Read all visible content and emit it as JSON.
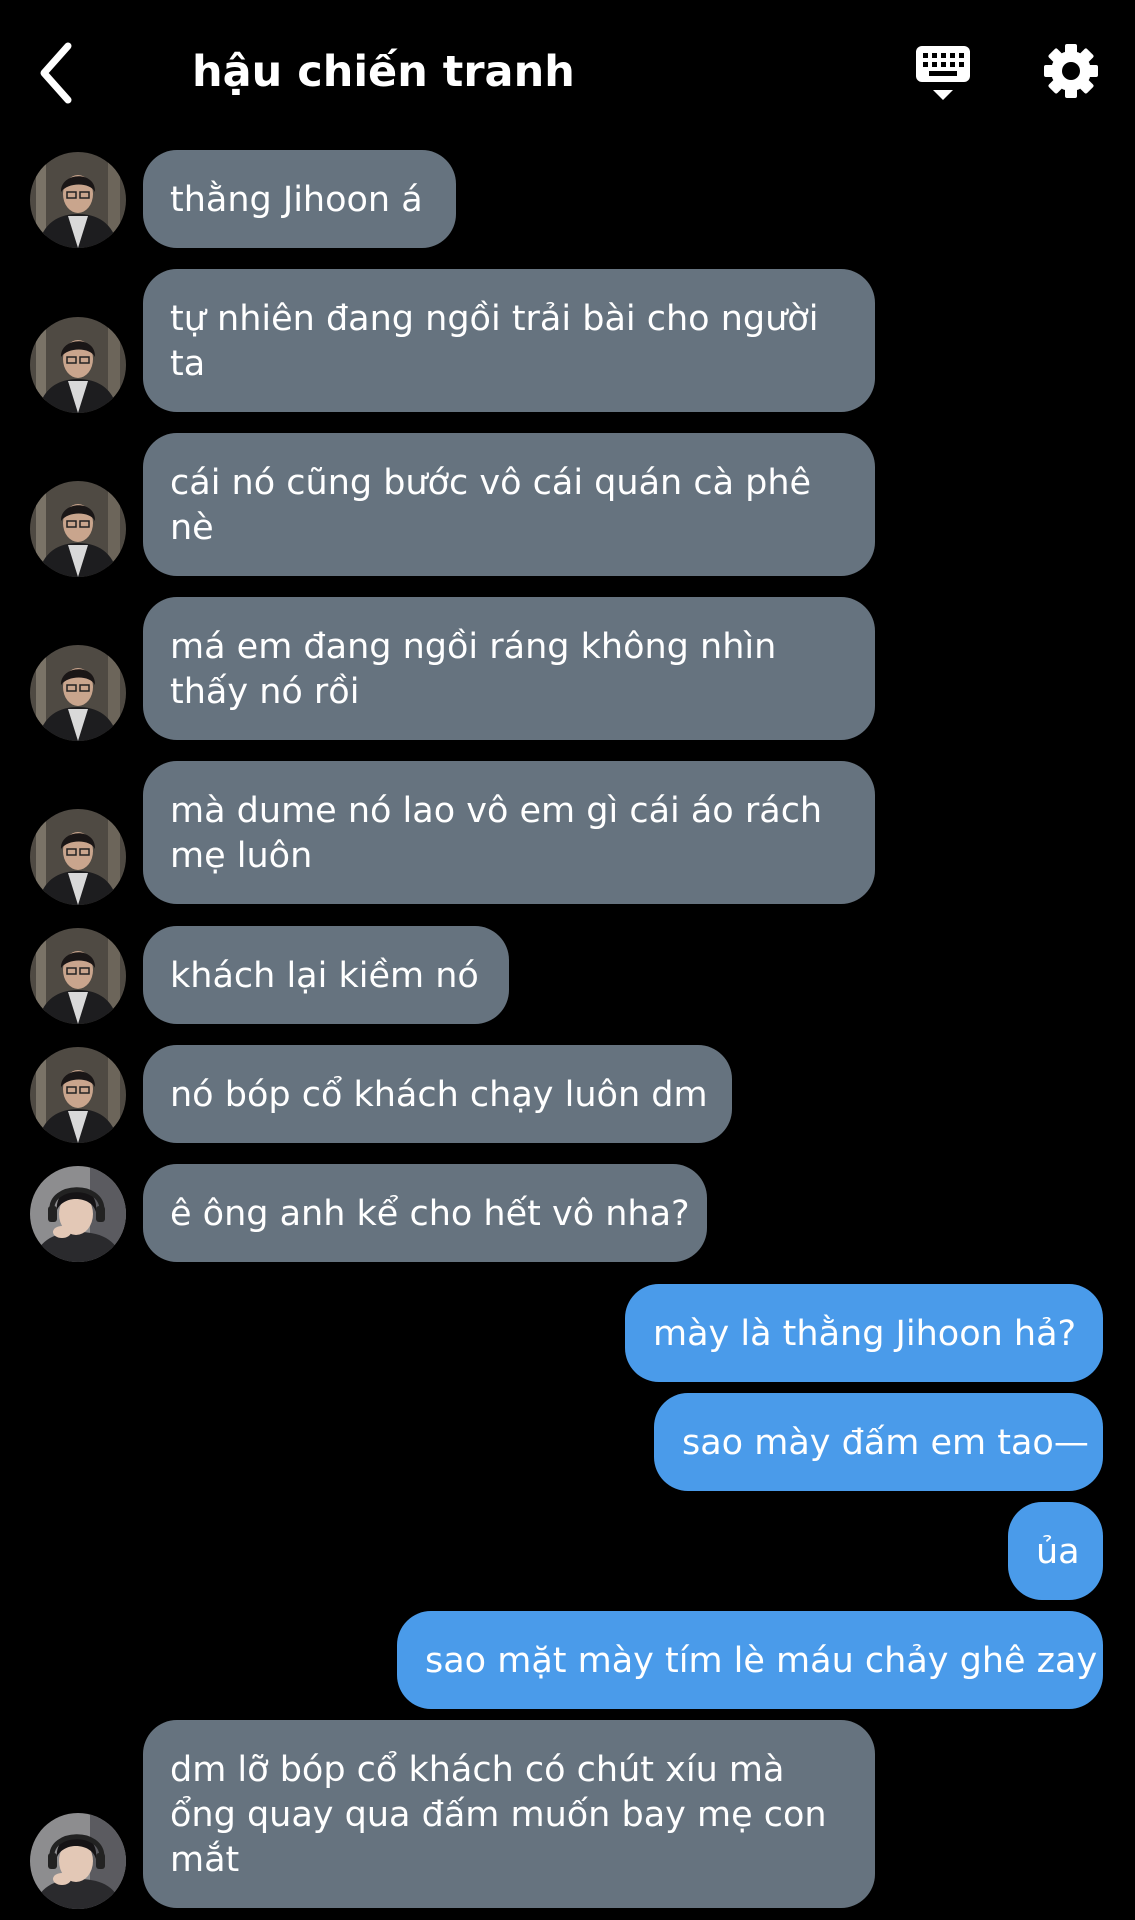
{
  "header": {
    "title": "hậu chiến tranh",
    "back_icon": "chevron-left-icon",
    "keyboard_icon": "keyboard-icon",
    "settings_icon": "gear-icon"
  },
  "colors": {
    "background": "#000000",
    "incoming_bubble": "#66737f",
    "outgoing_bubble": "#4a9bea",
    "text": "#ffffff"
  },
  "messages": [
    {
      "sender": "incoming",
      "avatar": "avatar-glasses",
      "lines": [
        "thằng Jihoon á"
      ]
    },
    {
      "sender": "incoming",
      "avatar": "avatar-glasses",
      "lines": [
        "tự nhiên đang ngồi trải bài cho người",
        "ta"
      ]
    },
    {
      "sender": "incoming",
      "avatar": "avatar-glasses",
      "lines": [
        "cái nó cũng bước vô cái quán cà phê",
        "nè"
      ]
    },
    {
      "sender": "incoming",
      "avatar": "avatar-glasses",
      "lines": [
        "má em đang ngồi ráng không nhìn",
        "thấy nó rồi"
      ]
    },
    {
      "sender": "incoming",
      "avatar": "avatar-glasses",
      "lines": [
        "mà dume nó lao vô em gì cái áo rách",
        "mẹ luôn"
      ]
    },
    {
      "sender": "incoming",
      "avatar": "avatar-glasses",
      "lines": [
        "khách lại kiềm nó"
      ]
    },
    {
      "sender": "incoming",
      "avatar": "avatar-glasses",
      "lines": [
        "nó bóp cổ khách chạy luôn dm"
      ]
    },
    {
      "sender": "incoming",
      "avatar": "avatar-headphones",
      "lines": [
        "ê ông anh kể cho hết vô nha?"
      ]
    },
    {
      "sender": "outgoing",
      "lines": [
        "mày là thằng Jihoon hả?"
      ]
    },
    {
      "sender": "outgoing",
      "lines": [
        "sao mày đấm em tao—"
      ]
    },
    {
      "sender": "outgoing",
      "lines": [
        "ủa"
      ]
    },
    {
      "sender": "outgoing",
      "lines": [
        "sao mặt mày tím lè máu chảy ghê zay"
      ]
    },
    {
      "sender": "incoming",
      "avatar": "avatar-headphones",
      "lines": [
        "dm lỡ bóp cổ khách có chút xíu mà",
        "ổng quay qua đấm muốn bay mẹ con",
        "mắt"
      ]
    }
  ]
}
